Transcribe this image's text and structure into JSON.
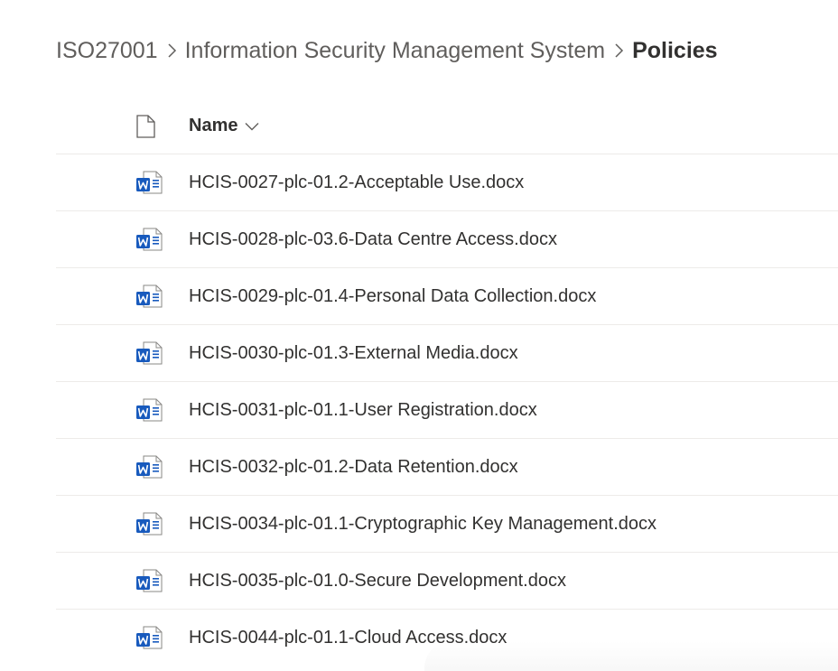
{
  "breadcrumb": {
    "items": [
      {
        "label": "ISO27001"
      },
      {
        "label": "Information Security Management System"
      },
      {
        "label": "Policies"
      }
    ]
  },
  "list": {
    "header": {
      "name_label": "Name",
      "file_type_icon": "document-icon",
      "sort_icon": "chevron-down-icon"
    },
    "file_icon": "word-document-icon",
    "files": [
      {
        "name": "HCIS-0027-plc-01.2-Acceptable Use.docx"
      },
      {
        "name": "HCIS-0028-plc-03.6-Data Centre Access.docx"
      },
      {
        "name": "HCIS-0029-plc-01.4-Personal Data Collection.docx"
      },
      {
        "name": "HCIS-0030-plc-01.3-External Media.docx"
      },
      {
        "name": "HCIS-0031-plc-01.1-User Registration.docx"
      },
      {
        "name": "HCIS-0032-plc-01.2-Data Retention.docx"
      },
      {
        "name": "HCIS-0034-plc-01.1-Cryptographic Key Management.docx"
      },
      {
        "name": "HCIS-0035-plc-01.0-Secure Development.docx"
      },
      {
        "name": "HCIS-0044-plc-01.1-Cloud Access.docx"
      }
    ]
  },
  "colors": {
    "text_primary": "#323130",
    "text_secondary": "#605e5c",
    "divider": "#edebe9",
    "word_blue": "#185abd"
  }
}
